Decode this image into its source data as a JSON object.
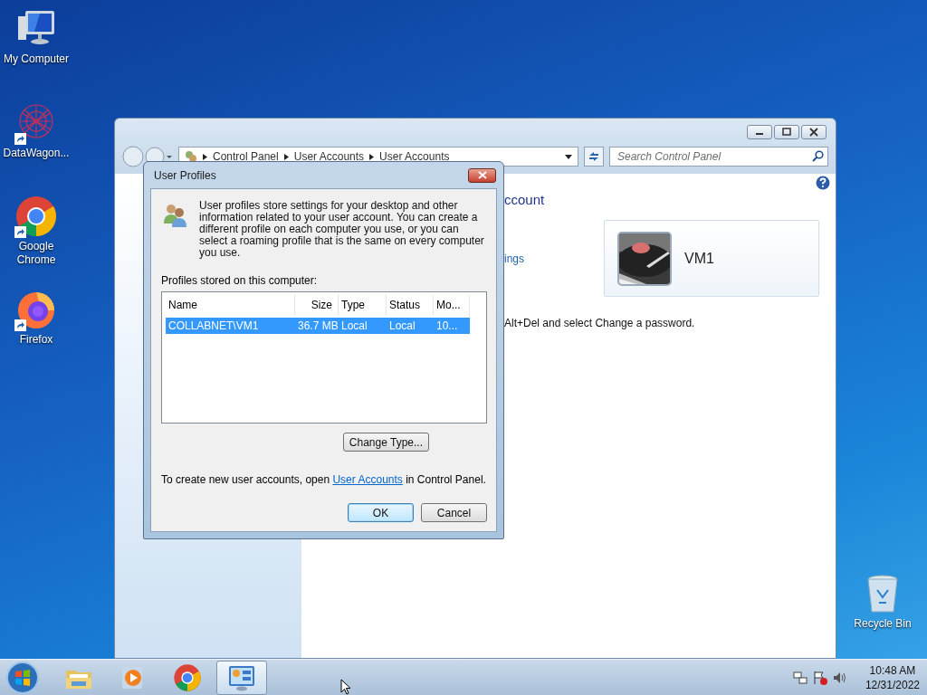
{
  "desktop_icons": [
    {
      "kind": "computer",
      "label": "My Computer",
      "shortcut": false
    },
    {
      "kind": "web",
      "label": "DataWagon...",
      "shortcut": true
    },
    {
      "kind": "chrome",
      "label": "Google Chrome",
      "shortcut": true
    },
    {
      "kind": "firefox",
      "label": "Firefox",
      "shortcut": true
    },
    {
      "kind": "bin",
      "label": "Recycle Bin",
      "shortcut": false
    }
  ],
  "control_panel": {
    "breadcrumb": [
      "Control Panel",
      "User Accounts",
      "User Accounts"
    ],
    "search": {
      "placeholder": "Search Control Panel"
    },
    "heading": "ccount",
    "link": "ings",
    "note": "Alt+Del and select Change a password.",
    "account": {
      "name": "VM1"
    }
  },
  "dialog": {
    "title": "User Profiles",
    "description": "User profiles store settings for your desktop and other information related to your user account. You can create a different profile on each computer you use, or you can select a roaming profile that is the same on every computer you use.",
    "list_label": "Profiles stored on this computer:",
    "columns": [
      "Name",
      "Size",
      "Type",
      "Status",
      "Mo..."
    ],
    "rows": [
      {
        "cells": [
          "COLLABNET\\VM1",
          "36.7 MB",
          "Local",
          "Local",
          "10..."
        ],
        "selected": true
      }
    ],
    "change_type_button": "Change Type...",
    "footer": {
      "before": "To create new user accounts, open ",
      "link": "User Accounts",
      "after": " in Control Panel."
    },
    "buttons": [
      {
        "label": "OK",
        "default": true
      },
      {
        "label": "Cancel",
        "default": false
      }
    ]
  },
  "taskbar": {
    "items": [
      {
        "kind": "folder",
        "selected": false
      },
      {
        "kind": "player",
        "selected": false
      },
      {
        "kind": "chrome",
        "selected": false
      },
      {
        "kind": "control",
        "selected": true
      }
    ],
    "time": "10:48 AM",
    "date": "12/31/2022"
  }
}
